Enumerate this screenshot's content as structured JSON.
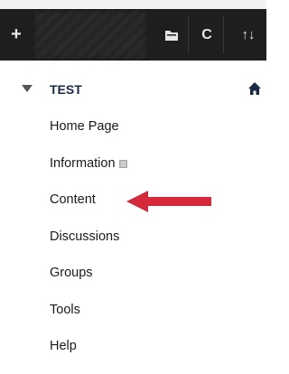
{
  "toolbar": {
    "icons": [
      "plus-icon",
      "folder-icon",
      "refresh-icon",
      "sort-icon"
    ],
    "add_label": "+",
    "refresh_label": "C",
    "sort_label": "↑↓"
  },
  "course": {
    "title": "TEST"
  },
  "menu": {
    "items": [
      {
        "label": "Home Page"
      },
      {
        "label": "Information"
      },
      {
        "label": "Content"
      },
      {
        "label": "Discussions"
      },
      {
        "label": "Groups"
      },
      {
        "label": "Tools"
      },
      {
        "label": "Help"
      }
    ]
  },
  "colors": {
    "toolbar_bg": "#1e1e1e",
    "course_title": "#1b2a44",
    "arrow": "#d62a3c"
  }
}
